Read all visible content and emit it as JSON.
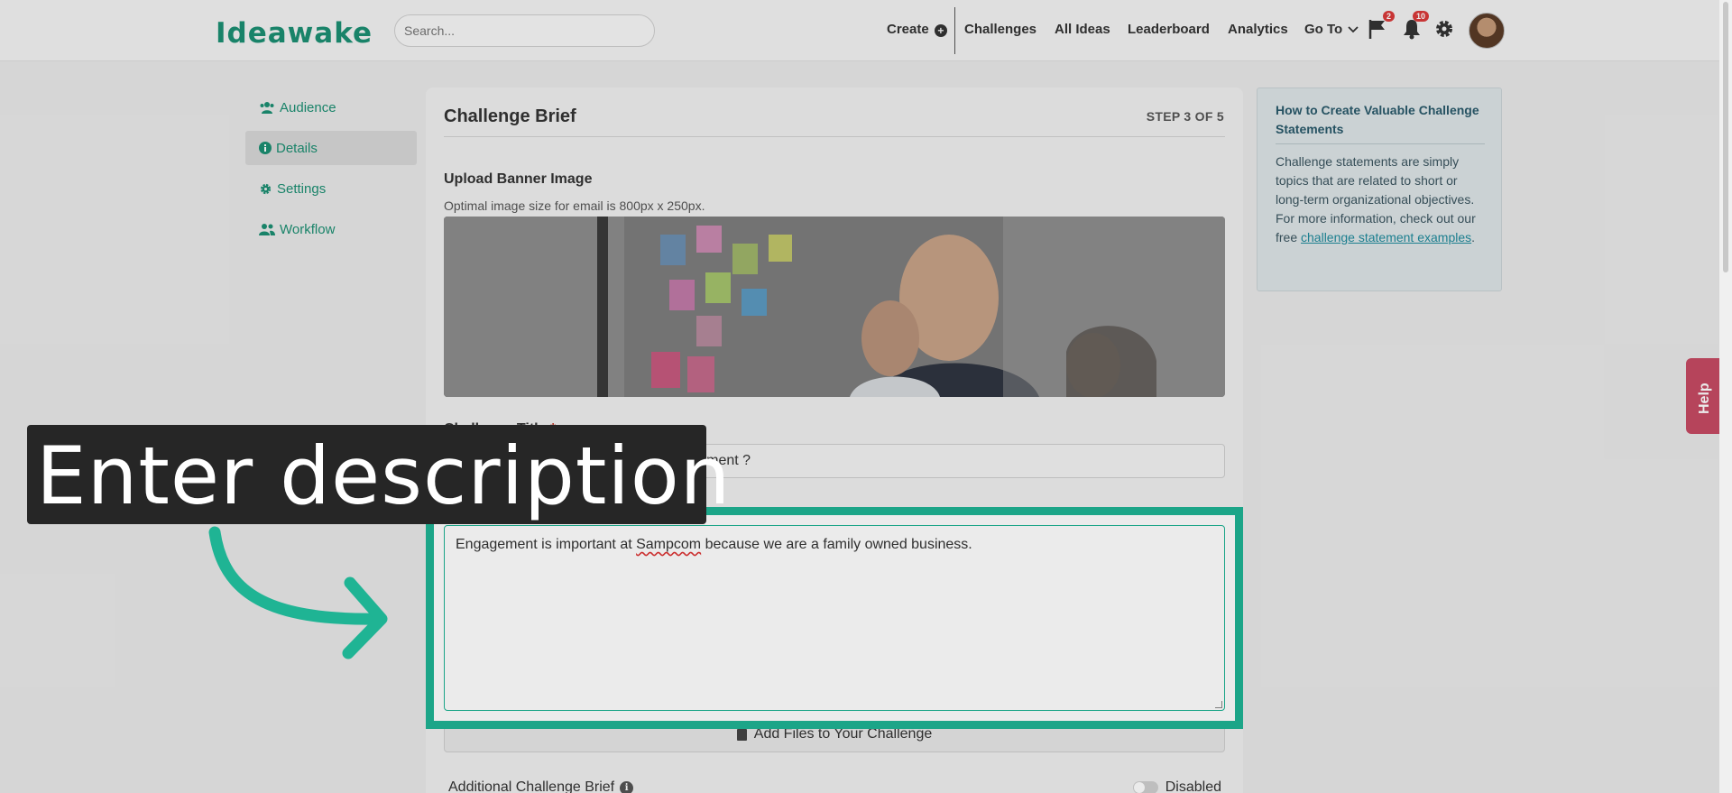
{
  "nav": {
    "logo": "Ideawake",
    "search_placeholder": "Search...",
    "create": "Create",
    "challenges": "Challenges",
    "all_ideas": "All Ideas",
    "leaderboard": "Leaderboard",
    "analytics": "Analytics",
    "go_to": "Go To",
    "flag_badge": "2",
    "bell_badge": "10"
  },
  "sidebar": {
    "items": [
      {
        "label": "Audience",
        "icon": "users-icon"
      },
      {
        "label": "Details",
        "icon": "info-circle-icon"
      },
      {
        "label": "Settings",
        "icon": "gear-icon"
      },
      {
        "label": "Workflow",
        "icon": "user-group-icon"
      }
    ],
    "active": "Details"
  },
  "card": {
    "title": "Challenge Brief",
    "step": "STEP 3 OF 5",
    "upload_label": "Upload Banner Image",
    "upload_hint": "Optimal image size for email is 800px x 250px.",
    "challenge_title_label": "Challenge Title",
    "challenge_title_required": "*",
    "challenge_title_value": "How can we improve employee engagement ?",
    "description_value_pre": "Engagement is important at ",
    "description_misspelled": "Sampcom",
    "description_value_post": " because we are a family owned business.",
    "add_files": "Add Files to Your Challenge",
    "additional_brief": "Additional Challenge Brief",
    "toggle_state": "Disabled"
  },
  "tip": {
    "title": "How to Create Valuable Challenge Statements",
    "body": "Challenge statements are simply topics that are related to short or long-term organizational objectives. For more information, check out our free ",
    "link": "challenge statement examples",
    "end": "."
  },
  "help_tab": "Help",
  "annotation": {
    "text": "Enter description"
  },
  "colors": {
    "brand": "#1c8f72",
    "highlight": "#1fb494",
    "badge": "#d93a3a",
    "help": "#c64a63"
  }
}
